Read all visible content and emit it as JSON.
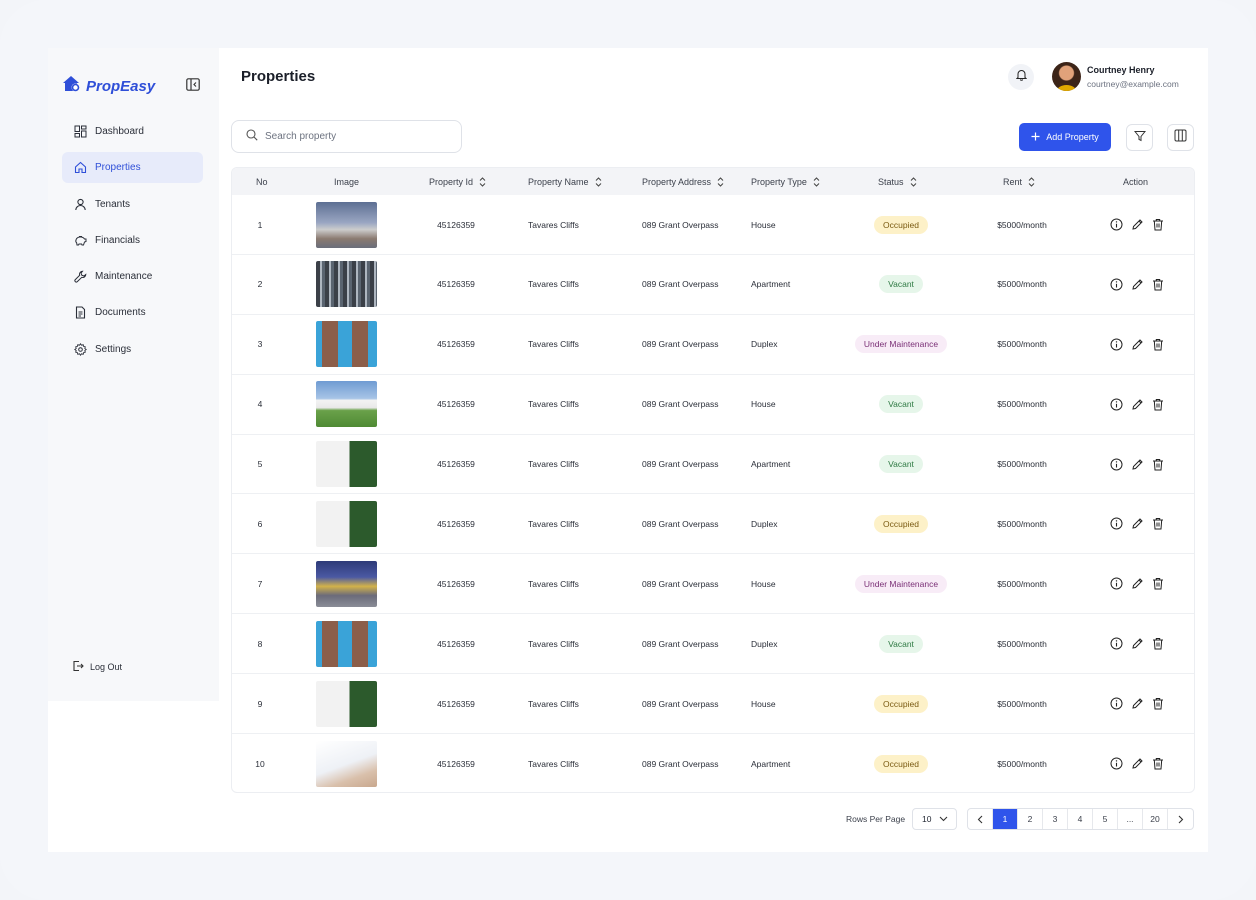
{
  "brand": {
    "name": "PropEasy",
    "accent": "#2f54eb"
  },
  "sidebar": {
    "items": [
      {
        "label": "Dashboard",
        "icon": "dashboard-icon",
        "active": false
      },
      {
        "label": "Properties",
        "icon": "home-icon",
        "active": true
      },
      {
        "label": "Tenants",
        "icon": "user-icon",
        "active": false
      },
      {
        "label": "Financials",
        "icon": "piggy-bank-icon",
        "active": false
      },
      {
        "label": "Maintenance",
        "icon": "wrench-icon",
        "active": false
      },
      {
        "label": "Documents",
        "icon": "document-icon",
        "active": false
      },
      {
        "label": "Settings",
        "icon": "gear-icon",
        "active": false
      }
    ],
    "logout_label": "Log Out"
  },
  "header": {
    "title": "Properties",
    "user": {
      "name": "Courtney Henry",
      "email": "courtney@example.com"
    }
  },
  "toolbar": {
    "search_placeholder": "Search property",
    "add_label": "Add Property"
  },
  "table": {
    "columns": [
      "No",
      "Image",
      "Property Id",
      "Property Name",
      "Property Address",
      "Property Type",
      "Status",
      "Rent",
      "Action"
    ],
    "rows": [
      {
        "no": "1",
        "image": "house-dusk",
        "id": "45126359",
        "name": "Tavares Cliffs",
        "address": "089 Grant Overpass",
        "type": "House",
        "status": "Occupied",
        "rent": "$5000/month"
      },
      {
        "no": "2",
        "image": "tower-grey",
        "id": "45126359",
        "name": "Tavares Cliffs",
        "address": "089 Grant Overpass",
        "type": "Apartment",
        "status": "Vacant",
        "rent": "$5000/month"
      },
      {
        "no": "3",
        "image": "tower-blue",
        "id": "45126359",
        "name": "Tavares Cliffs",
        "address": "089 Grant Overpass",
        "type": "Duplex",
        "status": "Under Maintenance",
        "rent": "$5000/month"
      },
      {
        "no": "4",
        "image": "house-lawn",
        "id": "45126359",
        "name": "Tavares Cliffs",
        "address": "089 Grant Overpass",
        "type": "House",
        "status": "Vacant",
        "rent": "$5000/month"
      },
      {
        "no": "5",
        "image": "house-tree",
        "id": "45126359",
        "name": "Tavares Cliffs",
        "address": "089 Grant Overpass",
        "type": "Apartment",
        "status": "Vacant",
        "rent": "$5000/month"
      },
      {
        "no": "6",
        "image": "house-tree",
        "id": "45126359",
        "name": "Tavares Cliffs",
        "address": "089 Grant Overpass",
        "type": "Duplex",
        "status": "Occupied",
        "rent": "$5000/month"
      },
      {
        "no": "7",
        "image": "house-night",
        "id": "45126359",
        "name": "Tavares Cliffs",
        "address": "089 Grant Overpass",
        "type": "House",
        "status": "Under Maintenance",
        "rent": "$5000/month"
      },
      {
        "no": "8",
        "image": "tower-blue",
        "id": "45126359",
        "name": "Tavares Cliffs",
        "address": "089 Grant Overpass",
        "type": "Duplex",
        "status": "Vacant",
        "rent": "$5000/month"
      },
      {
        "no": "9",
        "image": "house-tree",
        "id": "45126359",
        "name": "Tavares Cliffs",
        "address": "089 Grant Overpass",
        "type": "House",
        "status": "Occupied",
        "rent": "$5000/month"
      },
      {
        "no": "10",
        "image": "desk",
        "id": "45126359",
        "name": "Tavares Cliffs",
        "address": "089 Grant Overpass",
        "type": "Apartment",
        "status": "Occupied",
        "rent": "$5000/month"
      }
    ]
  },
  "pagination": {
    "rows_per_page_label": "Rows Per Page",
    "rows_per_page": "10",
    "pages": [
      "1",
      "2",
      "3",
      "4",
      "5",
      "...",
      "20"
    ],
    "current": "1"
  },
  "status_colors": {
    "Occupied": "#fdf1c8",
    "Vacant": "#e6f6ea",
    "Under Maintenance": "#f8ecf7"
  }
}
